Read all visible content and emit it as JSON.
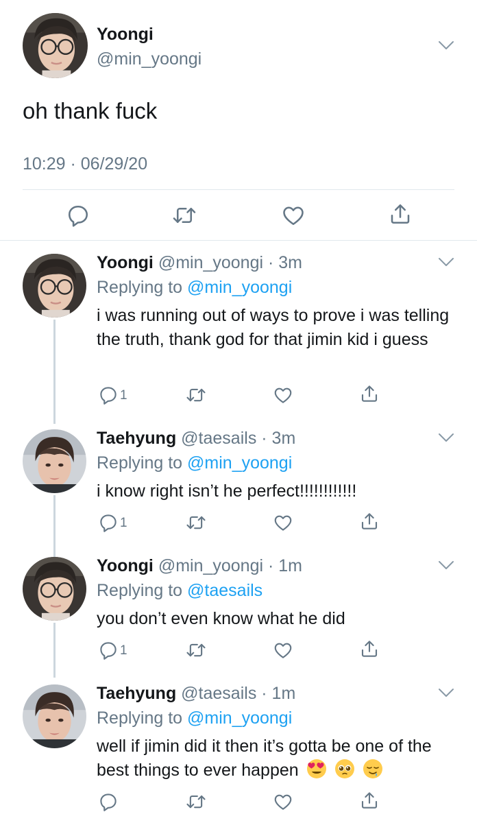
{
  "main_tweet": {
    "name": "Yoongi",
    "handle": "@min_yoongi",
    "text": "oh thank fuck",
    "timestamp": "10:29 · 06/29/20",
    "avatar": "yoongi-avatar",
    "actions": [
      "reply-icon",
      "retweet-icon",
      "like-icon",
      "share-icon"
    ]
  },
  "replies": [
    {
      "name": "Yoongi",
      "handle": "@min_yoongi",
      "time": "3m",
      "replying_label": "Replying to",
      "replying_to": "@min_yoongi",
      "text": "i was running out of ways to prove i was telling the truth, thank god for that jimin kid i guess",
      "reply_count": "1",
      "avatar": "yoongi-avatar"
    },
    {
      "name": "Taehyung",
      "handle": "@taesails",
      "time": "3m",
      "replying_label": "Replying to",
      "replying_to": "@min_yoongi",
      "text": "i know right isn’t he perfect!!!!!!!!!!!!",
      "reply_count": "1",
      "avatar": "taehyung-avatar"
    },
    {
      "name": "Yoongi",
      "handle": "@min_yoongi",
      "time": "1m",
      "replying_label": "Replying to",
      "replying_to": "@taesails",
      "text": "you don’t even know what he did",
      "reply_count": "1",
      "avatar": "yoongi-avatar"
    },
    {
      "name": "Taehyung",
      "handle": "@taesails",
      "time": "1m",
      "replying_label": "Replying to",
      "replying_to": "@min_yoongi",
      "text": "well if jimin did it then it’s gotta be one of the best things to ever happen",
      "emojis": [
        "heart-eyes-emoji",
        "pleading-face-emoji",
        "relieved-face-emoji"
      ],
      "reply_count": "",
      "avatar": "taehyung-avatar"
    }
  ],
  "colors": {
    "text": "#14171a",
    "secondary": "#657786",
    "link": "#1da1f2",
    "divider": "#e1e8ed"
  }
}
